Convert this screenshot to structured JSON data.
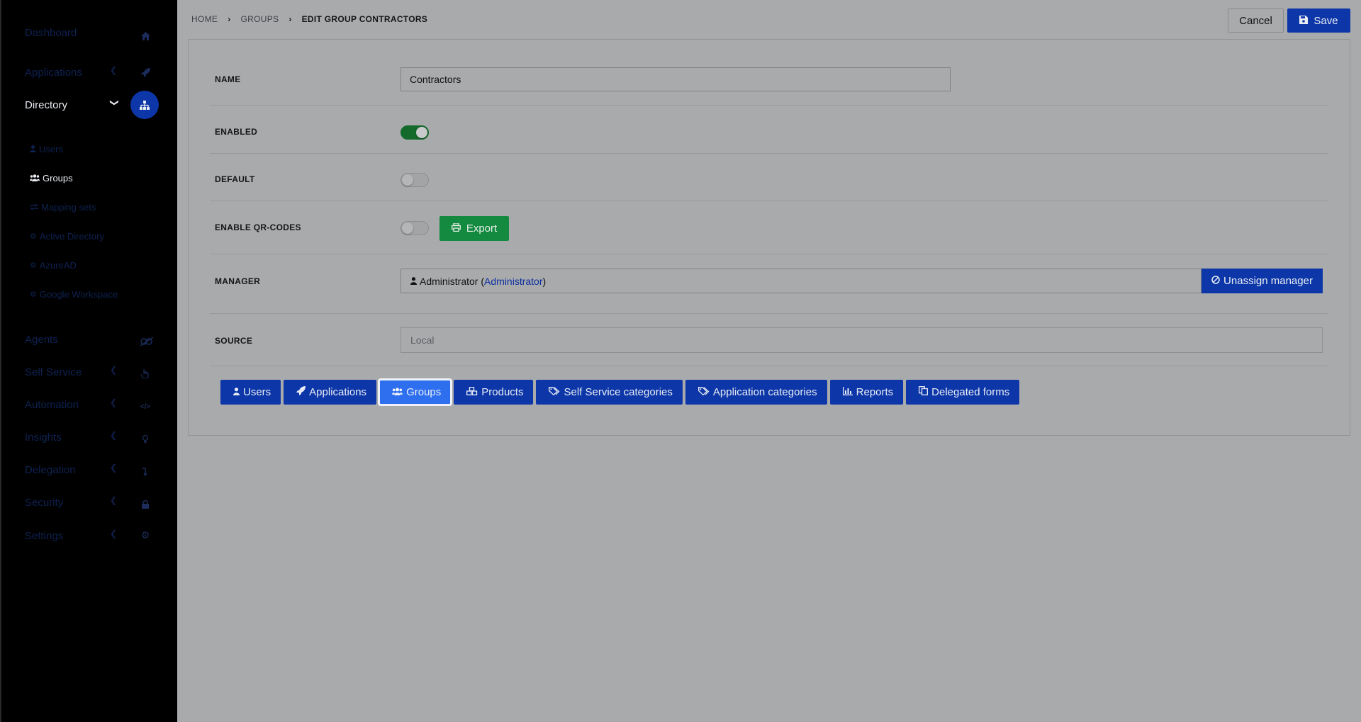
{
  "sidebar": {
    "items": [
      {
        "label": "Dashboard",
        "icon": "home-icon",
        "has_chevron": false
      },
      {
        "label": "Applications",
        "icon": "rocket-icon",
        "has_chevron": true
      },
      {
        "label": "Directory",
        "icon": "sitemap-icon",
        "has_chevron": true,
        "active": true
      },
      {
        "label": "Agents",
        "icon": "agents-icon",
        "has_chevron": false
      },
      {
        "label": "Self Service",
        "icon": "hand-pointer-icon",
        "has_chevron": true
      },
      {
        "label": "Automation",
        "icon": "code-icon",
        "has_chevron": true
      },
      {
        "label": "Insights",
        "icon": "lightbulb-icon",
        "has_chevron": true
      },
      {
        "label": "Delegation",
        "icon": "level-down-icon",
        "has_chevron": true
      },
      {
        "label": "Security",
        "icon": "lock-icon",
        "has_chevron": true
      },
      {
        "label": "Settings",
        "icon": "gear-icon",
        "has_chevron": true
      }
    ],
    "directory_sub": [
      {
        "label": "Users",
        "icon": "user-icon"
      },
      {
        "label": "Groups",
        "icon": "users-icon",
        "active": true
      },
      {
        "label": "Mapping sets",
        "icon": "exchange-icon"
      },
      {
        "label": "Active Directory",
        "icon": "gear-icon"
      },
      {
        "label": "AzureAD",
        "icon": "gear-icon"
      },
      {
        "label": "Google Workspace",
        "icon": "gear-icon"
      }
    ]
  },
  "breadcrumb": {
    "home": "HOME",
    "groups": "GROUPS",
    "current": "EDIT GROUP CONTRACTORS"
  },
  "actions": {
    "cancel": "Cancel",
    "save": "Save"
  },
  "form": {
    "name_label": "NAME",
    "name_value": "Contractors",
    "enabled_label": "ENABLED",
    "enabled": true,
    "default_label": "DEFAULT",
    "default": false,
    "qr_label": "ENABLE QR-CODES",
    "qr_enabled": false,
    "export_label": "Export",
    "manager_label": "MANAGER",
    "manager_name": "Administrator (",
    "manager_link": "Administrator",
    "manager_close": ")",
    "unassign_label": "Unassign manager",
    "source_label": "SOURCE",
    "source_value": "Local"
  },
  "tabs": [
    {
      "label": "Users",
      "icon": "user-icon"
    },
    {
      "label": "Applications",
      "icon": "rocket-icon"
    },
    {
      "label": "Groups",
      "icon": "users-icon",
      "active": true
    },
    {
      "label": "Products",
      "icon": "cubes-icon"
    },
    {
      "label": "Self Service categories",
      "icon": "tags-icon"
    },
    {
      "label": "Application categories",
      "icon": "tags-icon"
    },
    {
      "label": "Reports",
      "icon": "bar-chart-icon"
    },
    {
      "label": "Delegated forms",
      "icon": "copy-icon"
    }
  ],
  "colors": {
    "primary": "#0d37a8",
    "active_tab": "#2e6ff0",
    "success": "#138a3f",
    "toggle_on": "#136a2a"
  }
}
